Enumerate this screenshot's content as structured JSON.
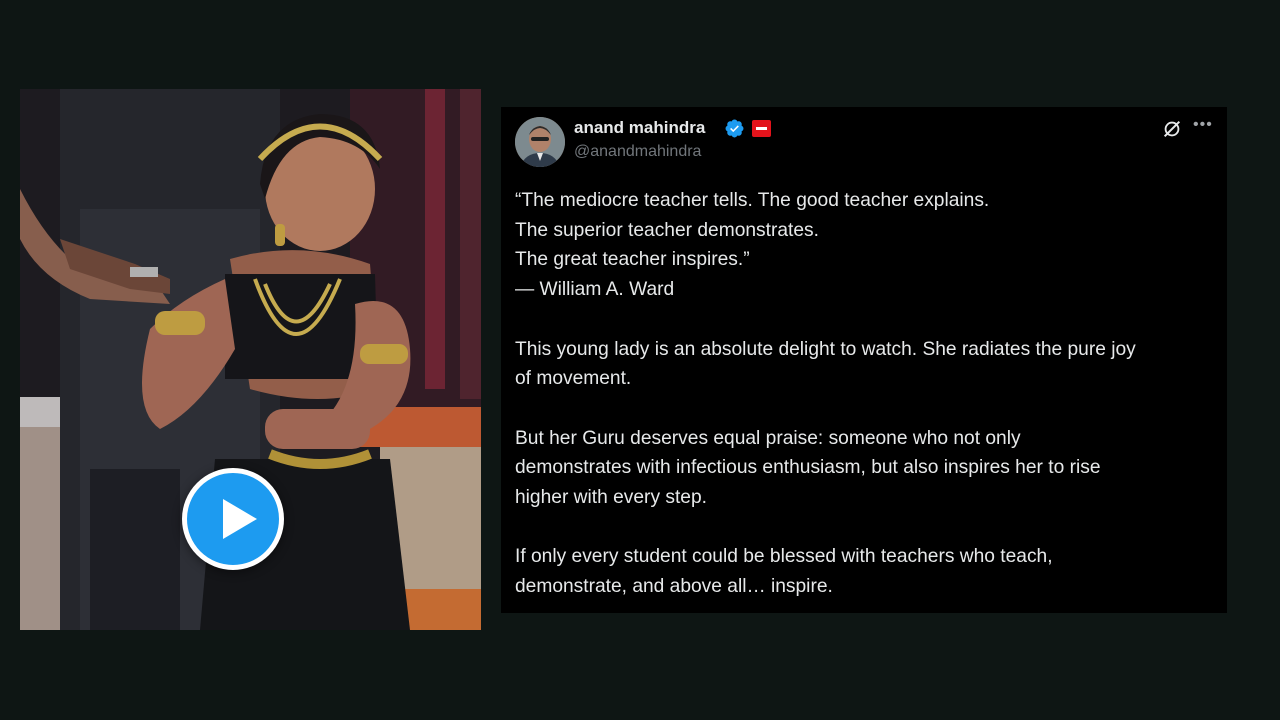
{
  "post": {
    "author_name": "anand mahindra",
    "author_handle": "@anandmahindra",
    "icons": {
      "verified": "verified-badge-icon",
      "affiliate": "affiliate-badge-icon",
      "grok": "grok-icon",
      "more": "more-icon",
      "play": "play-icon"
    },
    "colors": {
      "accent": "#1d9bf0",
      "background": "#000000",
      "text": "#e7e9ea",
      "secondary_text": "#71767b",
      "affiliate_badge": "#e3131b"
    },
    "quote_lines": [
      "“The mediocre teacher tells. The good teacher explains.",
      "The superior teacher demonstrates.",
      "The great teacher inspires.”",
      "— William A. Ward"
    ],
    "paragraph_2_lines": [
      "This young lady is an absolute delight to watch. She radiates the pure joy",
      "of movement."
    ],
    "paragraph_3_lines": [
      "But her Guru deserves equal praise: someone who not only",
      "demonstrates with infectious enthusiasm, but also inspires her to rise",
      "higher with every step."
    ],
    "paragraph_4_lines": [
      "If only every student could be blessed with teachers who teach,",
      "demonstrate, and above all… inspire."
    ]
  }
}
